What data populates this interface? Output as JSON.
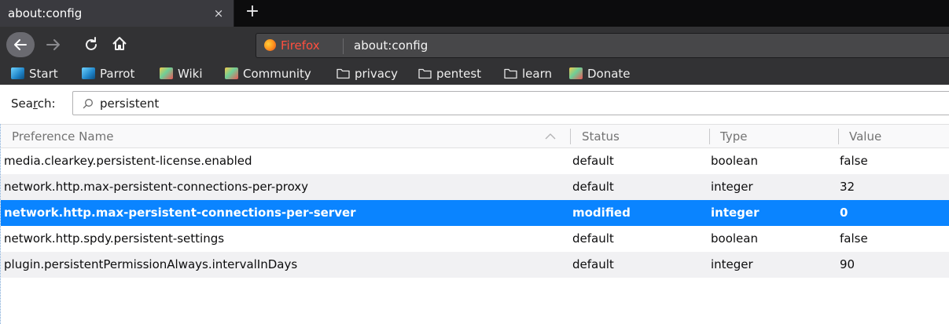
{
  "tab": {
    "title": "about:config",
    "close_glyph": "×",
    "new_tab_glyph": "+"
  },
  "urlbar": {
    "identity_label": "Firefox",
    "url": "about:config"
  },
  "bookmarks": [
    {
      "label": "Start",
      "icon": "parrot-icon"
    },
    {
      "label": "Parrot",
      "icon": "parrot-icon"
    },
    {
      "label": "Wiki",
      "icon": "wiki-icon"
    },
    {
      "label": "Community",
      "icon": "wiki-icon"
    },
    {
      "label": "privacy",
      "icon": "folder-icon"
    },
    {
      "label": "pentest",
      "icon": "folder-icon"
    },
    {
      "label": "learn",
      "icon": "folder-icon"
    },
    {
      "label": "Donate",
      "icon": "wiki-icon"
    }
  ],
  "search": {
    "label_prefix": "Sea",
    "label_access": "r",
    "label_suffix": "ch:",
    "value": "persistent"
  },
  "table": {
    "headers": {
      "name": "Preference Name",
      "status": "Status",
      "type": "Type",
      "value": "Value"
    },
    "rows": [
      {
        "name": "media.clearkey.persistent-license.enabled",
        "status": "default",
        "type": "boolean",
        "value": "false"
      },
      {
        "name": "network.http.max-persistent-connections-per-proxy",
        "status": "default",
        "type": "integer",
        "value": "32"
      },
      {
        "name": "network.http.max-persistent-connections-per-server",
        "status": "modified",
        "type": "integer",
        "value": "0"
      },
      {
        "name": "network.http.spdy.persistent-settings",
        "status": "default",
        "type": "boolean",
        "value": "false"
      },
      {
        "name": "plugin.persistentPermissionAlways.intervalInDays",
        "status": "default",
        "type": "integer",
        "value": "90"
      }
    ],
    "selected_index": 2
  },
  "colors": {
    "selection": "#0a84ff",
    "toolbar": "#323234",
    "identity": "#ff4f3f"
  }
}
